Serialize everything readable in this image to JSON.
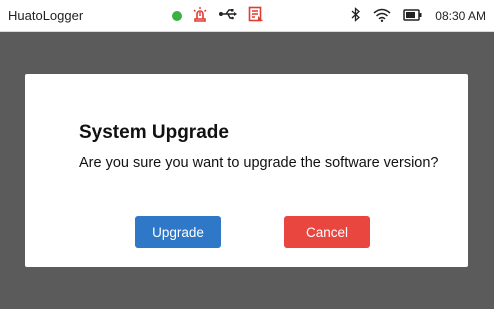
{
  "statusbar": {
    "app_title": "HuatoLogger",
    "time": "08:30 AM",
    "icons": [
      "status-dot-icon",
      "alarm-icon",
      "usb-icon",
      "report-icon",
      "bluetooth-icon",
      "wifi-icon",
      "battery-icon"
    ],
    "colors": {
      "status_dot": "#3cb043",
      "alert": "#e03c31"
    }
  },
  "dialog": {
    "title": "System Upgrade",
    "message": "Are you sure you want to upgrade the software version?",
    "upgrade_label": "Upgrade",
    "cancel_label": "Cancel",
    "colors": {
      "upgrade": "#2e78c7",
      "cancel": "#e8463f"
    }
  }
}
